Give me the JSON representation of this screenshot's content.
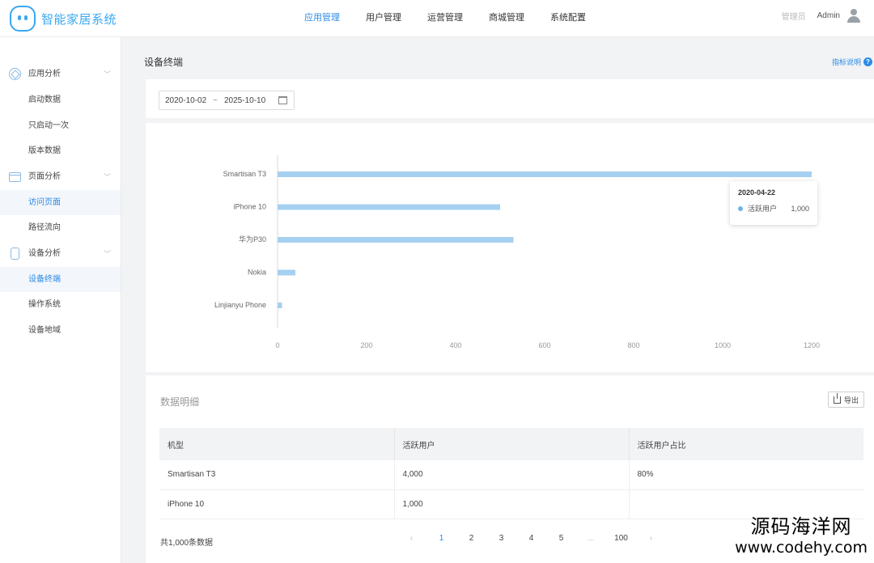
{
  "app": {
    "title": "智能家居系统"
  },
  "topnav": [
    {
      "label": "应用管理",
      "active": true
    },
    {
      "label": "用户管理",
      "active": false
    },
    {
      "label": "运营管理",
      "active": false
    },
    {
      "label": "商城管理",
      "active": false
    },
    {
      "label": "系统配置",
      "active": false
    }
  ],
  "user": {
    "role": "管理员",
    "name": "Admin"
  },
  "sidebar": {
    "groups": [
      {
        "label": "应用分析",
        "icon": "app-icon",
        "items": [
          "启动数据",
          "只启动一次",
          "版本数据"
        ]
      },
      {
        "label": "页面分析",
        "icon": "page-icon",
        "items": [
          "访问页面",
          "路径流向"
        ]
      },
      {
        "label": "设备分析",
        "icon": "device-icon",
        "items": [
          "设备终端",
          "操作系统",
          "设备地域"
        ]
      }
    ],
    "active_items": [
      "访问页面",
      "设备终端"
    ]
  },
  "page": {
    "title": "设备终端",
    "help_label": "指标说明"
  },
  "filter": {
    "date_start": "2020-10-02",
    "separator": "~",
    "date_end": "2025-10-10"
  },
  "chart_data": {
    "type": "bar",
    "orientation": "horizontal",
    "categories": [
      "Smartisan T3",
      "iPhone 10",
      "华为P30",
      "Nokia",
      "Linjianyu Phone"
    ],
    "values": [
      1200,
      500,
      530,
      40,
      10
    ],
    "xlim": [
      0,
      1200
    ],
    "xticks": [
      0,
      200,
      400,
      600,
      800,
      1000,
      1200
    ],
    "grid": false,
    "color": "#a6d0f0"
  },
  "tooltip": {
    "date": "2020-04-22",
    "series_name": "活跃用户",
    "value": "1,000"
  },
  "details": {
    "title": "数据明细",
    "export_label": "导出",
    "columns": [
      "机型",
      "活跃用户",
      "活跃用户占比"
    ],
    "rows": [
      [
        "Smartisan T3",
        "4,000",
        "80%"
      ],
      [
        "iPhone 10",
        "1,000",
        ""
      ]
    ],
    "total_label": "共1,000条数据",
    "pages": [
      "1",
      "2",
      "3",
      "4",
      "5",
      "...",
      "100"
    ],
    "current_page": "1"
  },
  "watermark": {
    "line1": "源码海洋网",
    "line2": "www.codehy.com"
  }
}
